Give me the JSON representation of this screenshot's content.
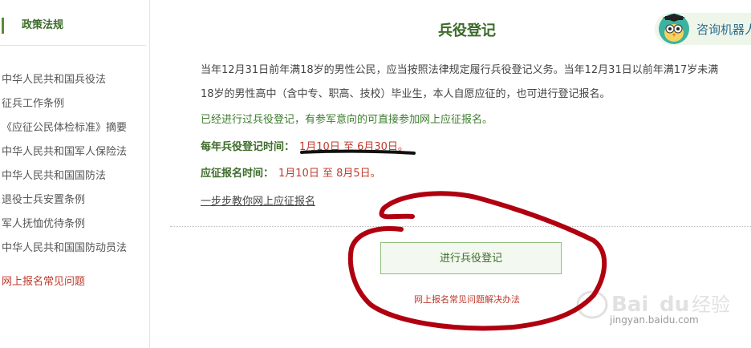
{
  "sidebar": {
    "heading": "政策法规",
    "items": [
      "中华人民共和国兵役法",
      "征兵工作条例",
      "《应征公民体检标准》摘要",
      "中华人民共和国军人保险法",
      "中华人民共和国国防法",
      "退役士兵安置条例",
      "军人抚恤优待条例",
      "中华人民共和国国防动员法"
    ],
    "faq": "网上报名常见问题"
  },
  "main": {
    "title": "兵役登记",
    "robot_label": "咨询机器人",
    "para1": "当年12月31日前年满18岁的男性公民，应当按照法律规定履行兵役登记义务。当年12月31日以前年满17岁未满",
    "para2": "18岁的男性高中（含中专、职高、技校）毕业生，本人自愿应征的，也可进行登记报名。",
    "green_note": "已经进行过兵役登记，有参军意向的可直接参加网上应征报名。",
    "reg_time_label": "每年兵役登记时间：",
    "reg_time_value": "1月10日 至 6月30日。",
    "apply_time_label": "应征报名时间：",
    "apply_time_value": "1月10日 至 8月5日。",
    "guide_link": "一步步教你网上应征报名",
    "register_button": "进行兵役登记",
    "faq_link": "网上报名常见问题解决办法"
  },
  "watermark": {
    "brand": "Baidu 经验",
    "url": "jingyan.baidu.com"
  },
  "colors": {
    "accent_green": "#3d6b2a",
    "date_red": "#c0392b",
    "annotation_red": "#b00010"
  }
}
